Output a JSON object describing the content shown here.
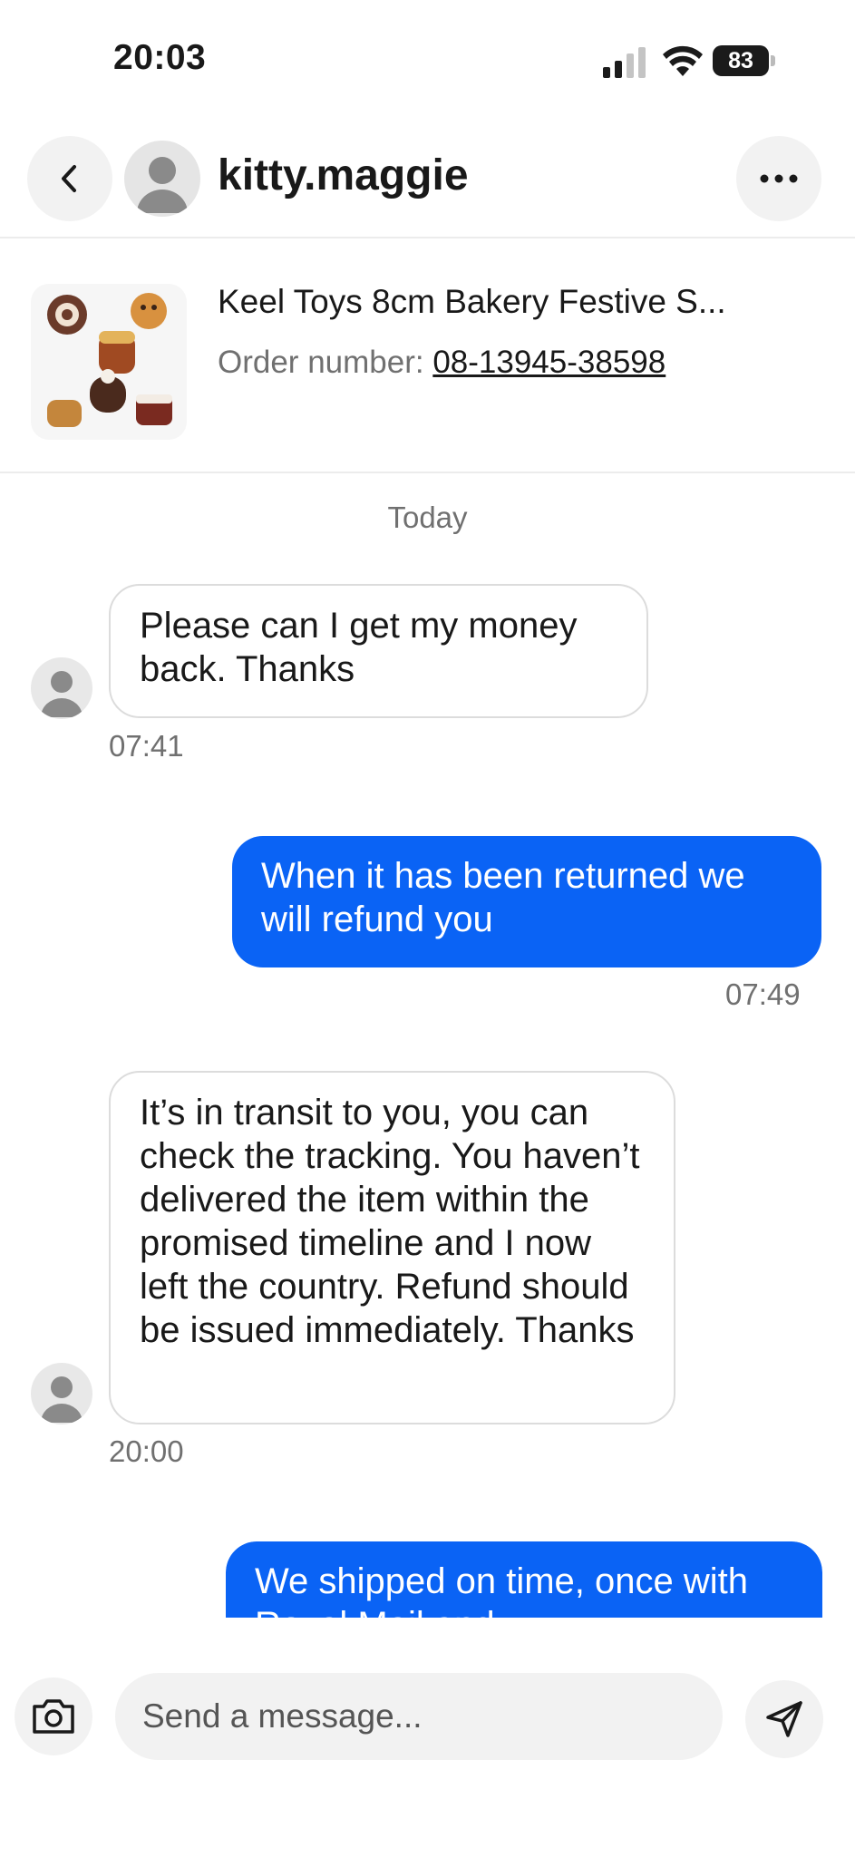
{
  "status_bar": {
    "time": "20:03",
    "battery": "83"
  },
  "header": {
    "username": "kitty.maggie"
  },
  "item": {
    "title": "Keel Toys 8cm Bakery Festive S...",
    "order_label": "Order number:",
    "order_number": "08-13945-38598"
  },
  "chat": {
    "day_label": "Today",
    "messages": [
      {
        "direction": "incoming",
        "text": "Please can I get my money back. Thanks",
        "time": "07:41"
      },
      {
        "direction": "outgoing",
        "text": "When it has been returned we will refund you",
        "time": "07:49"
      },
      {
        "direction": "incoming",
        "text": "It’s in transit to you, you can check the tracking. You haven’t delivered the item within the promised timeline and I now left the country. Refund should be issued immediately. Thanks",
        "time": "20:00"
      },
      {
        "direction": "outgoing",
        "text": "We shipped on time, once with Royal Mail and..."
      }
    ]
  },
  "composer": {
    "placeholder": "Send a message..."
  },
  "colors": {
    "accent": "#0a63f5",
    "bubble_border": "#dcdcdc",
    "muted_text": "#707070"
  },
  "icons": [
    "back-chevron-icon",
    "avatar-icon",
    "more-icon",
    "camera-icon",
    "send-icon",
    "signal-icon",
    "wifi-icon",
    "battery-icon"
  ]
}
